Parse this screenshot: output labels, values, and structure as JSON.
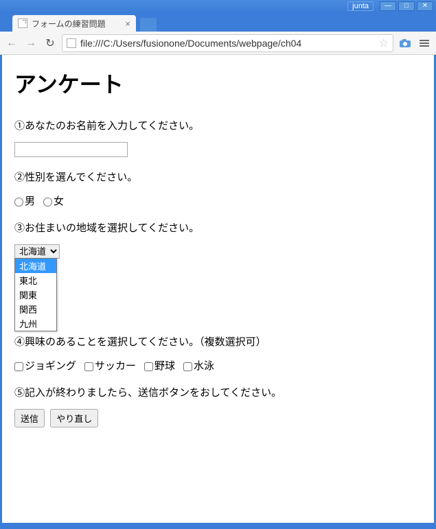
{
  "window": {
    "username": "junta"
  },
  "tab": {
    "title": "フォームの練習問題"
  },
  "url": "file:///C:/Users/fusionone/Documents/webpage/ch04",
  "page": {
    "heading": "アンケート",
    "q1": "①あなたのお名前を入力してください。",
    "q2": "②性別を選んでください。",
    "gender": {
      "male": "男",
      "female": "女"
    },
    "q3": "③お住まいの地域を選択してください。",
    "region_selected": "北海道",
    "regions": [
      "北海道",
      "東北",
      "関東",
      "関西",
      "九州"
    ],
    "q4": "④興味のあることを選択してください。（複数選択可）",
    "interests": {
      "jogging": "ジョギング",
      "soccer": "サッカー",
      "baseball": "野球",
      "swimming": "水泳"
    },
    "q5": "⑤記入が終わりましたら、送信ボタンをおしてください。",
    "submit": "送信",
    "reset": "やり直し"
  }
}
